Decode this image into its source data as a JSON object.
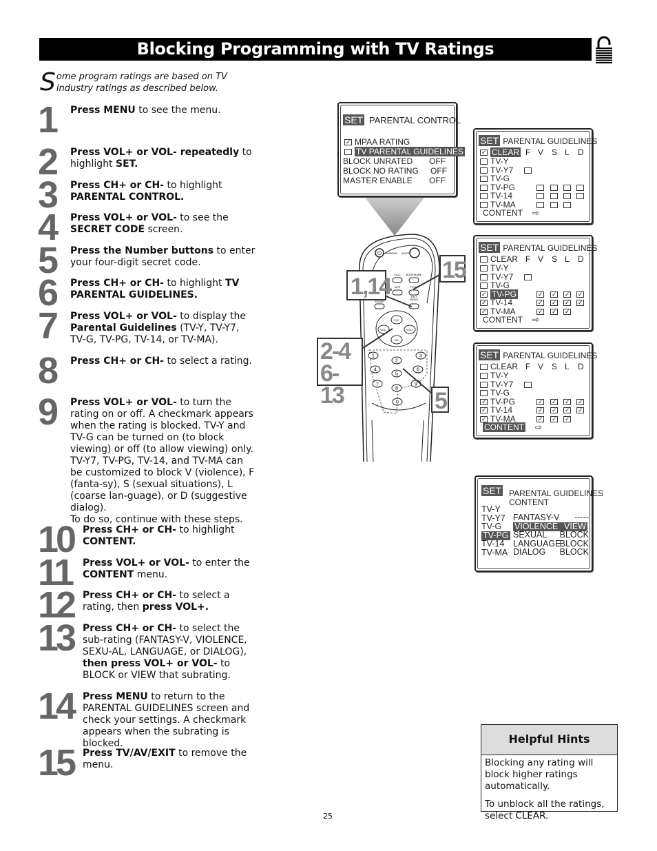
{
  "title": "Blocking Programming with TV Ratings",
  "intro": {
    "dropcap": "S",
    "text": "ome program ratings are based on TV industry ratings as described below."
  },
  "steps": [
    {
      "num": "1",
      "html": "<b>Press MENU</b> to see the menu."
    },
    {
      "num": "2",
      "html": "<b>Press VOL+ or VOL- repeatedly</b> to highlight <b>SET.</b>"
    },
    {
      "num": "3",
      "html": "<b>Press CH+ or CH-</b> to highlight <b>PARENTAL CONTROL.</b>"
    },
    {
      "num": "4",
      "html": "<b>Press VOL+ or VOL-</b> to see the <b>SECRET CODE</b> screen."
    },
    {
      "num": "5",
      "html": "<b>Press the Number buttons</b> to enter your four-digit secret code."
    },
    {
      "num": "6",
      "html": "<b>Press CH+ or CH-</b> to highlight <b>TV PARENTAL GUIDELINES.</b>"
    },
    {
      "num": "7",
      "html": "<b>Press VOL+ or VOL-</b> to display the <b>Parental Guidelines</b> (TV-Y, TV-Y7, TV-G, TV-PG, TV-14, or TV-MA)."
    },
    {
      "num": "8",
      "html": "<b>Press CH+ or CH-</b> to select a rating."
    },
    {
      "num": "9",
      "html": "<b>Press VOL+ or VOL-</b> to turn the rating on or off. A checkmark appears when the rating is blocked. TV-Y and TV-G can be turned on (to block viewing) or off (to allow viewing) only.<br>TV-Y7, TV-PG, TV-14, and TV-MA can be customized to block V (violence), F (fanta-sy), S (sexual situations), L (coarse lan-guage), or D (suggestive dialog).<br>To do so, continue with these steps."
    },
    {
      "num": "10",
      "html": "<b>Press CH+ or CH-</b> to highlight <b>CONTENT.</b>"
    },
    {
      "num": "11",
      "html": "<b>Press VOL+ or VOL-</b> to enter the <b>CONTENT</b> menu."
    },
    {
      "num": "12",
      "html": "<b>Press CH+ or CH-</b> to select a rating, then <b>press VOL+.</b>"
    },
    {
      "num": "13",
      "html": "<b>Press CH+ or CH-</b> to select the sub-rating (FANTASY-V, VIOLENCE, SEXU-AL, LANGUAGE, or DIALOG), <b>then press VOL+ or VOL-</b> to BLOCK or VIEW that subrating."
    },
    {
      "num": "14",
      "html": "<b>Press MENU</b> to return to the PARENTAL GUIDELINES screen and check your settings. A checkmark appears when the subrating is blocked."
    },
    {
      "num": "15",
      "html": "<b>Press TV/AV/EXIT</b> to remove the menu."
    }
  ],
  "screen_parental_control": {
    "set": "SET",
    "title": "PARENTAL CONTROL",
    "mpaa": "MPAA RATING",
    "tvpg": "TV PARENTAL GUIDELINES",
    "rows": [
      {
        "label": "BLOCK UNRATED",
        "value": "OFF"
      },
      {
        "label": "BLOCK NO RATING",
        "value": "OFF"
      },
      {
        "label": "MASTER ENABLE",
        "value": "OFF"
      }
    ]
  },
  "guidelines_common": {
    "set": "SET",
    "title": "PARENTAL GUIDELINES",
    "clear": "CLEAR",
    "cols": [
      "F",
      "V",
      "S",
      "L",
      "D"
    ],
    "ratings": [
      "TV-Y",
      "TV-Y7",
      "TV-G",
      "TV-PG",
      "TV-14",
      "TV-MA"
    ],
    "content": "CONTENT",
    "arrow": "⇨"
  },
  "screen_content": {
    "set": "SET",
    "title": "PARENTAL GUIDELINES",
    "subtitle": "CONTENT",
    "ratings": [
      "TV-Y",
      "TV-Y7",
      "TV-G",
      "TV-PG",
      "TV-14",
      "TV-MA"
    ],
    "subratings": [
      {
        "label": "FANTASY-V",
        "value": "-----"
      },
      {
        "label": "VIOLENCE",
        "value": "VIEW"
      },
      {
        "label": "SEXUAL",
        "value": "BLOCK"
      },
      {
        "label": "LANGUAGE",
        "value": "BLOCK"
      },
      {
        "label": "DIALOG",
        "value": "BLOCK"
      }
    ]
  },
  "remote": {
    "standby": "STANDBY",
    "mute": "MUTE",
    "call": "CALL",
    "bookmark": "BOOKMARK",
    "mts": "MTS",
    "tvav": "TV/AV",
    "exit": "EXIT",
    "menu": "MENU",
    "smart": "SMART",
    "sound": "SOUND",
    "ch_up": "CH+",
    "ch_down": "CH-",
    "vol_minus": "VOL-",
    "vol_plus": "VOL+",
    "digits": [
      "1",
      "2",
      "3",
      "4",
      "5",
      "6",
      "7",
      "8",
      "9",
      "0"
    ],
    "callouts": {
      "c1": "1,14",
      "c15": "15",
      "c24": "2-4",
      "c613": "6-13",
      "c5": "5"
    }
  },
  "hints": {
    "title": "Helpful Hints",
    "p1": "Blocking any rating will block higher ratings automatically.",
    "p2": "To unblock all the ratings, select CLEAR."
  },
  "page_number": "25"
}
